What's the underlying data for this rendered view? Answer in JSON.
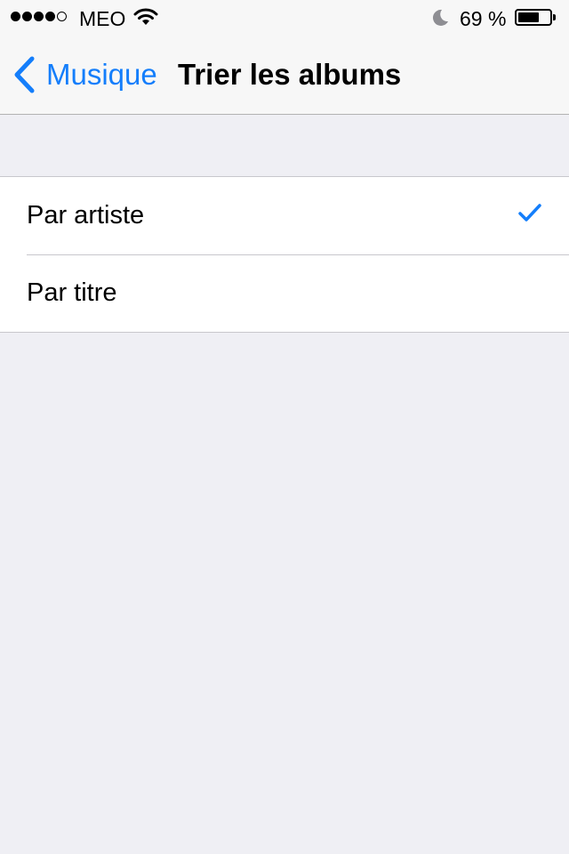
{
  "status_bar": {
    "carrier": "MEO",
    "battery_percent": "69 %",
    "battery_level": 0.69,
    "signal_bars_filled": 4,
    "signal_bars_total": 5
  },
  "nav": {
    "back_label": "Musique",
    "title": "Trier les albums"
  },
  "options": [
    {
      "label": "Par artiste",
      "selected": true
    },
    {
      "label": "Par titre",
      "selected": false
    }
  ],
  "colors": {
    "accent": "#147efb",
    "background": "#efeff4"
  },
  "icons": [
    "chevron-left-icon",
    "checkmark-icon",
    "wifi-icon",
    "moon-icon",
    "battery-icon"
  ]
}
